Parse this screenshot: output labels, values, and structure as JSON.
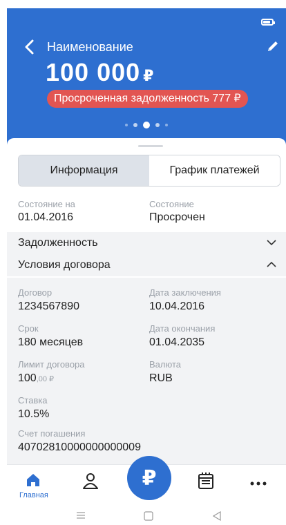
{
  "header": {
    "title": "Наименование",
    "amount": "100 000",
    "currency": "₽",
    "overdue": "Просроченная задолженность 777 ₽",
    "bg_color": "#2e6fd0",
    "overdue_color": "#e25552"
  },
  "tabs": [
    {
      "label": "Информация",
      "active": true
    },
    {
      "label": "График платежей",
      "active": false
    }
  ],
  "status": {
    "date_label": "Состояние на",
    "date_value": "01.04.2016",
    "state_label": "Состояние",
    "state_value": "Просрочен"
  },
  "sections": {
    "debt": "Задолженность",
    "terms": "Условия договора"
  },
  "details": {
    "contract_label": "Договор",
    "contract_value": "1234567890",
    "sign_date_label": "Дата заключения",
    "sign_date_value": "10.04.2016",
    "term_label": "Срок",
    "term_value": "180 месяцев",
    "end_date_label": "Дата окончания",
    "end_date_value": "01.04.2035",
    "limit_label": "Лимит договора",
    "limit_int": "100",
    "limit_frac": ",00 ₽",
    "currency_label": "Валюта",
    "currency_value": "RUB",
    "rate_label": "Ставка",
    "rate_value": "10.5%",
    "account_label": "Счет погашения",
    "account_value": "40702810000000000009"
  },
  "nav": {
    "home": "Главная",
    "fab_symbol": "₽",
    "icons": [
      "home-icon",
      "profile-icon",
      "ruble-icon",
      "calendar-icon",
      "more-icon"
    ]
  }
}
